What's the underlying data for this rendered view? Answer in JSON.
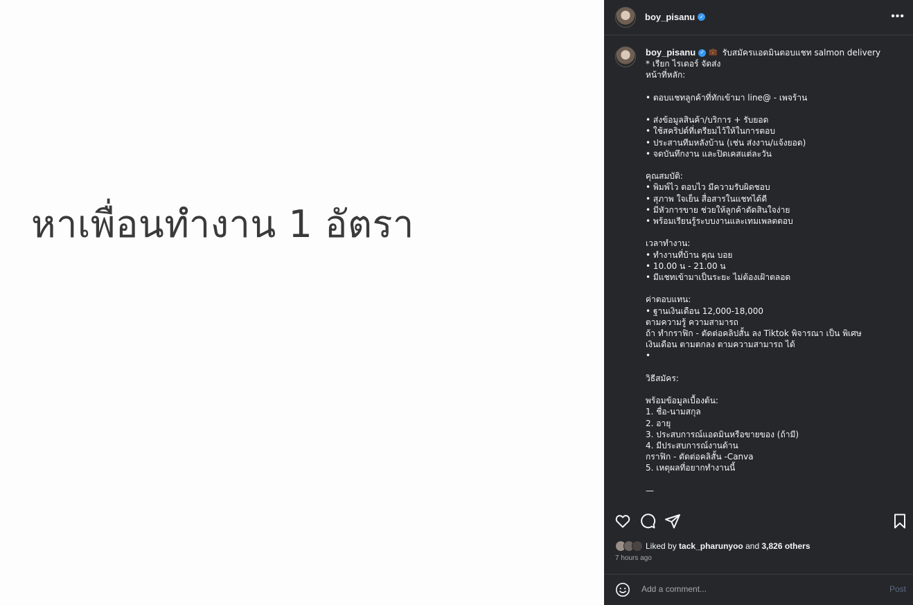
{
  "media": {
    "text": "หาเพื่อนทำงาน 1 อัตรา"
  },
  "post": {
    "username": "boy_pisanu",
    "verified": true,
    "more_icon": "more-horizontal-icon",
    "caption_title": "รับสมัครแอดมินตอบแชท salmon delivery",
    "caption_lines": [
      "* เรียก ไรเดอร์ จัดส่ง",
      "หน้าที่หลัก:",
      "",
      "• ตอบแชทลูกค้าที่ทักเข้ามา line@ - เพจร้าน",
      "",
      "• ส่งข้อมูลสินค้า/บริการ + รับยอด",
      "• ใช้สคริปต์ที่เตรียมไว้ให้ในการตอบ",
      "• ประสานทีมหลังบ้าน (เช่น ส่งงาน/แจ้งยอด)",
      "• จดบันทึกงาน และปิดเคสแต่ละวัน",
      "",
      "คุณสมบัติ:",
      "• พิมพ์ไว ตอบไว มีความรับผิดชอบ",
      "• สุภาพ ใจเย็น สื่อสารในแชทได้ดี",
      "• มีหัวการขาย ช่วยให้ลูกค้าตัดสินใจง่าย",
      "• พร้อมเรียนรู้ระบบงานและเทมเพลตตอบ",
      "",
      "เวลาทำงาน:",
      "• ทำงานที่บ้าน คุณ บอย",
      "• 10.00 น - 21.00 น",
      "• มีแชทเข้ามาเป็นระยะ ไม่ต้องเฝ้าตลอด",
      "",
      "ค่าตอบแทน:",
      "• ฐานเงินเดือน 12,000-18,000",
      "ตามความรู้ ความสามารถ",
      "ถ้า ทำกราฟิก - ตัดต่อคลิปสั้น ลง Tiktok พิจารณา เป็น พิเศษ",
      "เงินเดือน ตามตกลง ตามความสามารถ ได้",
      "•",
      "",
      "วิธีสมัคร:",
      "",
      "พร้อมข้อมูลเบื้องต้น:",
      "1. ชื่อ-นามสกุล",
      "2. อายุ",
      "3. ประสบการณ์แอดมินหรือขายของ (ถ้ามี)",
      "4. มีประสบการณ์งานด้าน",
      "กราฟิก - ตัดต่อคลิสั้น -Canva",
      "5. เหตุผลที่อยากทำงานนี้",
      "",
      "—"
    ],
    "liked_by_prefix": "Liked by",
    "liked_by_user": "tack_pharunyoo",
    "liked_by_and": "and",
    "liked_by_others": "3,826 others",
    "time_ago": "7 hours ago"
  },
  "comment": {
    "placeholder": "Add a comment...",
    "post_label": "Post"
  },
  "icons": {
    "like": "heart-icon",
    "comment": "comment-icon",
    "share": "send-icon",
    "save": "bookmark-icon",
    "emoji": "smile-icon"
  },
  "colors": {
    "panel_bg": "#25272b",
    "verified": "#3897f0",
    "post_button": "#5c6a80"
  }
}
